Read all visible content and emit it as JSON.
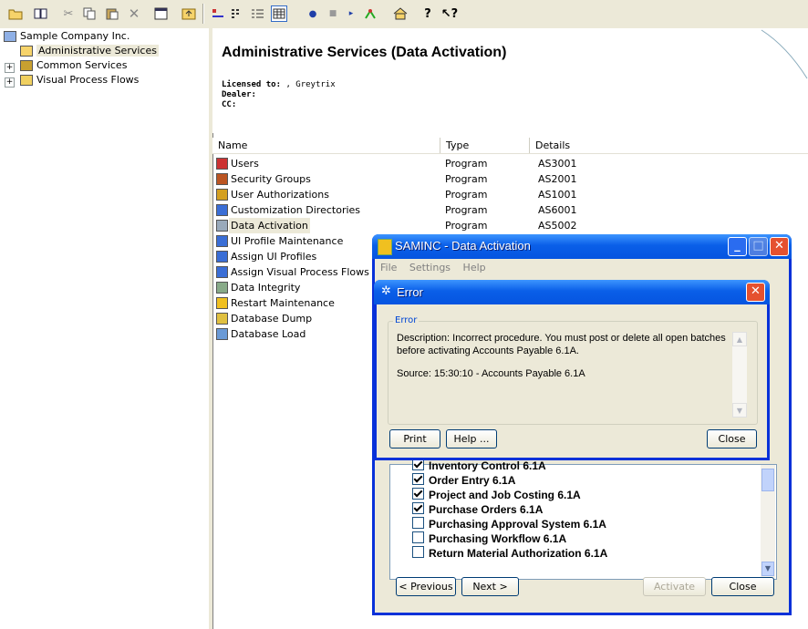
{
  "toolbar": {
    "icons": [
      "open-folder",
      "book",
      "cut",
      "copy",
      "paste",
      "delete",
      "properties",
      "up-folder",
      "large-icons",
      "small-icons",
      "list-view",
      "details-view",
      "dot",
      "square",
      "arrow",
      "workflow",
      "home",
      "help",
      "context-help"
    ]
  },
  "tree": {
    "root": "Sample Company Inc.",
    "items": [
      {
        "label": "Administrative Services",
        "expander": ""
      },
      {
        "label": "Common Services",
        "expander": "+"
      },
      {
        "label": "Visual Process Flows",
        "expander": "+"
      }
    ]
  },
  "header": {
    "title": "Administrative Services (Data Activation)",
    "licensed_label": "Licensed to:",
    "licensed_value": ", Greytrix",
    "dealer_label": "Dealer:",
    "cc_label": "CC:"
  },
  "list": {
    "columns": [
      "Name",
      "Type",
      "Details"
    ],
    "rows": [
      {
        "name": "Users",
        "type": "Program",
        "details": "AS3001"
      },
      {
        "name": "Security Groups",
        "type": "Program",
        "details": "AS2001"
      },
      {
        "name": "User Authorizations",
        "type": "Program",
        "details": "AS1001"
      },
      {
        "name": "Customization Directories",
        "type": "Program",
        "details": "AS6001"
      },
      {
        "name": "Data Activation",
        "type": "Program",
        "details": "AS5002"
      },
      {
        "name": "UI Profile Maintenance",
        "type": "",
        "details": ""
      },
      {
        "name": "Assign UI Profiles",
        "type": "",
        "details": ""
      },
      {
        "name": "Assign Visual Process Flows",
        "type": "",
        "details": ""
      },
      {
        "name": "Data Integrity",
        "type": "",
        "details": ""
      },
      {
        "name": "Restart Maintenance",
        "type": "",
        "details": ""
      },
      {
        "name": "Database Dump",
        "type": "",
        "details": ""
      },
      {
        "name": "Database Load",
        "type": "",
        "details": ""
      }
    ]
  },
  "activation_window": {
    "title": "SAMINC - Data Activation",
    "menu": [
      "File",
      "Settings",
      "Help"
    ],
    "modules": [
      {
        "label": "Inventory Control 6.1A",
        "checked": true
      },
      {
        "label": "Order Entry 6.1A",
        "checked": true
      },
      {
        "label": "Project and Job Costing 6.1A",
        "checked": true
      },
      {
        "label": "Purchase Orders 6.1A",
        "checked": true
      },
      {
        "label": "Purchasing Approval System 6.1A",
        "checked": false
      },
      {
        "label": "Purchasing Workflow 6.1A",
        "checked": false
      },
      {
        "label": "Return Material Authorization 6.1A",
        "checked": false
      }
    ],
    "previous_label": "< Previous",
    "next_label": "Next >",
    "activate_label": "Activate",
    "close_label": "Close"
  },
  "error_dialog": {
    "title": "Error",
    "group_label": "Error",
    "description": "Description: Incorrect procedure. You must post or delete all open batches before activating Accounts Payable 6.1A.",
    "source": "Source:  15:30:10 - Accounts Payable 6.1A",
    "print_label": "Print",
    "help_label": "Help ...",
    "close_label": "Close"
  },
  "colors": {
    "xp_blue": "#0831d9",
    "xp_face": "#ece9d8",
    "close_red": "#e5512f"
  }
}
